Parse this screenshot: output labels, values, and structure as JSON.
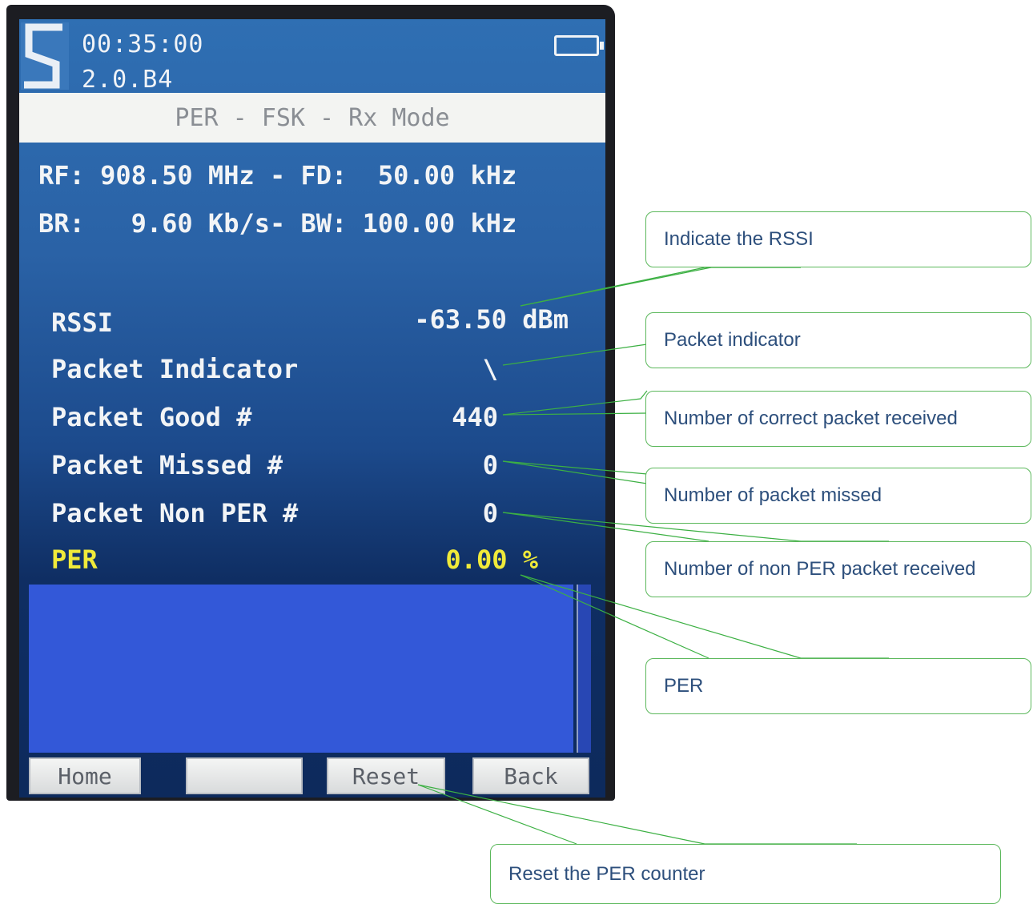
{
  "header": {
    "time": "00:35:00",
    "version": "2.0.B4",
    "mode_title": "PER - FSK - Rx Mode",
    "logo": "s-logo-icon",
    "battery": "battery-icon"
  },
  "config": {
    "line1": "RF: 908.50 MHz - FD:  50.00 kHz",
    "line2": "BR:   9.60 Kb/s- BW: 100.00 kHz"
  },
  "measurements": {
    "rssi": {
      "label": "RSSI",
      "value": "-63.50 dBm"
    },
    "indicator": {
      "label": "Packet Indicator",
      "value": "\\"
    },
    "good": {
      "label": "Packet Good #",
      "value": "440"
    },
    "missed": {
      "label": "Packet Missed #",
      "value": "0"
    },
    "non_per": {
      "label": "Packet Non PER #",
      "value": "0"
    },
    "per": {
      "label": "PER",
      "value": "0.00 %"
    }
  },
  "softkeys": {
    "home": "Home",
    "blank": "",
    "reset": "Reset",
    "back": "Back"
  },
  "callouts": {
    "rssi": "Indicate the RSSI",
    "indicator": "Packet indicator",
    "good": "Number of correct packet received",
    "missed": "Number of packet missed",
    "non_per": "Number of non PER packet received",
    "per": "PER",
    "reset": "Reset the PER counter"
  },
  "colors": {
    "screen_blue": "#2f6fb3",
    "highlight_yellow": "#f0ea3a",
    "callout_border": "#5cb85c",
    "callout_text": "#2d4f7c"
  }
}
